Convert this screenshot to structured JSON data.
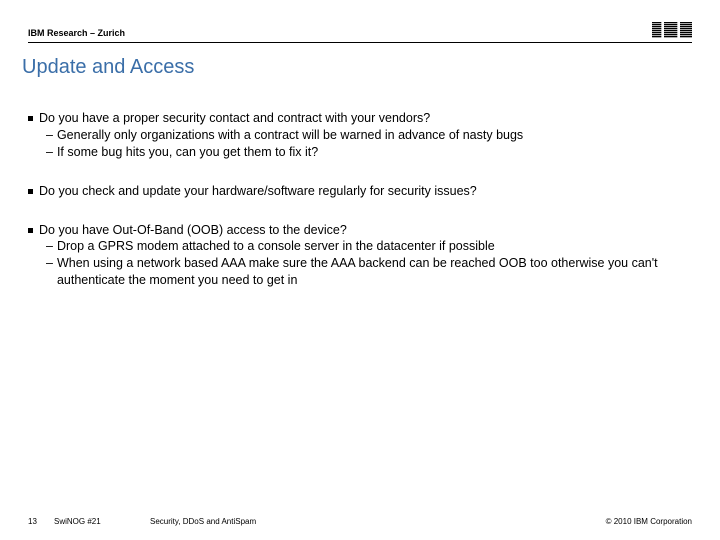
{
  "header": {
    "org_line": "IBM Research – Zurich",
    "logo_alt": "IBM"
  },
  "title": "Update and Access",
  "bullets": [
    {
      "text": "Do you have a proper security contact and contract with your vendors?",
      "subs": [
        "Generally only organizations with a contract will be warned in advance of nasty bugs",
        "If some bug hits you, can you get them to fix it?"
      ]
    },
    {
      "text": "Do you check and update your hardware/software regularly for security issues?",
      "subs": []
    },
    {
      "text": "Do you have Out-Of-Band (OOB) access to the device?",
      "subs": [
        "Drop a GPRS modem attached to a console server in the datacenter if possible",
        "When using a network based AAA make sure the AAA backend can be reached OOB too otherwise you can't authenticate the moment you need to get in"
      ]
    }
  ],
  "footer": {
    "page_number": "13",
    "event": "SwiNOG #21",
    "subject": "Security, DDoS and AntiSpam",
    "copyright": "© 2010 IBM Corporation"
  }
}
